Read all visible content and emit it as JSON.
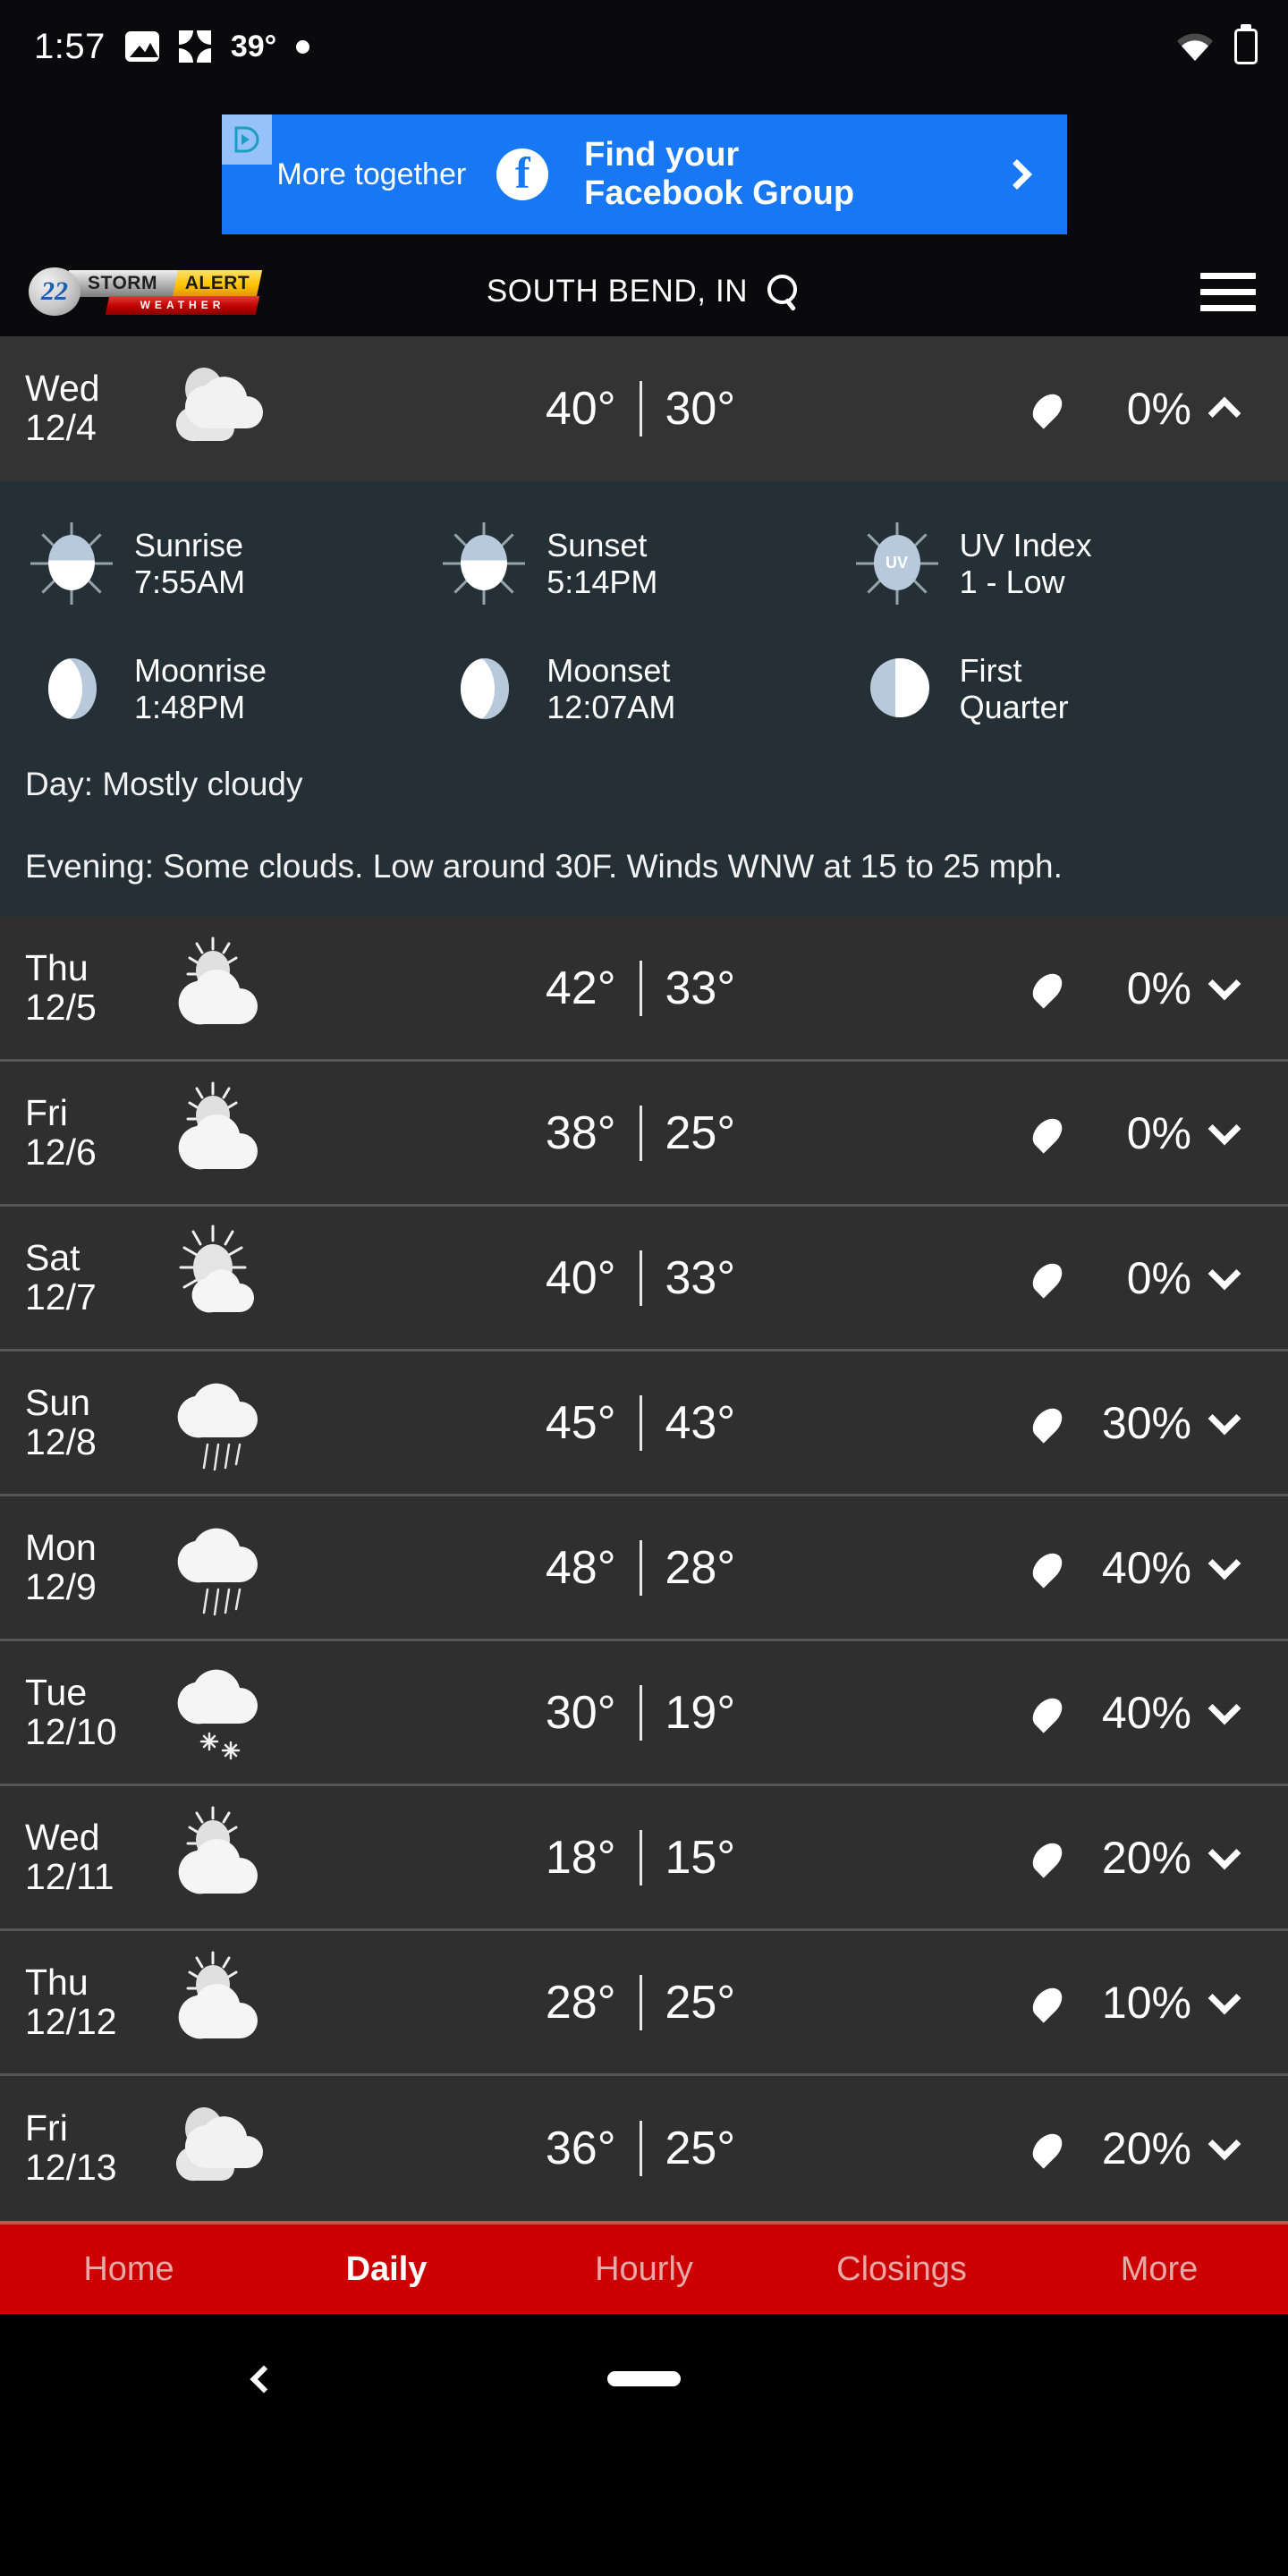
{
  "status_bar": {
    "time": "1:57",
    "temperature": "39°",
    "icons": [
      "photos-icon",
      "pinwheel-icon",
      "dot-icon",
      "wifi-icon",
      "battery-charging-icon"
    ]
  },
  "ad": {
    "badge": "ad-choices-icon",
    "tagline": "More together",
    "brand_icon": "facebook-icon",
    "headline_line1": "Find your",
    "headline_line2": "Facebook Group",
    "arrow": "chevron-right-icon",
    "bg_color": "#1877f2"
  },
  "header": {
    "logo": {
      "channel": "22",
      "word1": "STORM",
      "word2": "ALERT",
      "word3": "WEATHER"
    },
    "city": "SOUTH BEND, IN",
    "search_icon": "search-icon",
    "menu_icon": "hamburger-menu-icon"
  },
  "forecast": {
    "days": [
      {
        "day": "Wed",
        "date": "12/4",
        "icon": "mostly-cloudy-icon",
        "high": "40°",
        "low": "30°",
        "precip": "0%",
        "expanded": true
      },
      {
        "day": "Thu",
        "date": "12/5",
        "icon": "partly-sunny-icon",
        "high": "42°",
        "low": "33°",
        "precip": "0%",
        "expanded": false
      },
      {
        "day": "Fri",
        "date": "12/6",
        "icon": "partly-sunny-icon",
        "high": "38°",
        "low": "25°",
        "precip": "0%",
        "expanded": false
      },
      {
        "day": "Sat",
        "date": "12/7",
        "icon": "mostly-sunny-icon",
        "high": "40°",
        "low": "33°",
        "precip": "0%",
        "expanded": false
      },
      {
        "day": "Sun",
        "date": "12/8",
        "icon": "rain-icon",
        "high": "45°",
        "low": "43°",
        "precip": "30%",
        "expanded": false
      },
      {
        "day": "Mon",
        "date": "12/9",
        "icon": "rain-icon",
        "high": "48°",
        "low": "28°",
        "precip": "40%",
        "expanded": false
      },
      {
        "day": "Tue",
        "date": "12/10",
        "icon": "snow-icon",
        "high": "30°",
        "low": "19°",
        "precip": "40%",
        "expanded": false
      },
      {
        "day": "Wed",
        "date": "12/11",
        "icon": "partly-sunny-icon",
        "high": "18°",
        "low": "15°",
        "precip": "20%",
        "expanded": false
      },
      {
        "day": "Thu",
        "date": "12/12",
        "icon": "partly-sunny-icon",
        "high": "28°",
        "low": "25°",
        "precip": "10%",
        "expanded": false
      },
      {
        "day": "Fri",
        "date": "12/13",
        "icon": "mostly-cloudy-icon",
        "high": "36°",
        "low": "25°",
        "precip": "20%",
        "expanded": false
      }
    ],
    "expanded_detail": {
      "astro": [
        {
          "icon": "sunrise-icon",
          "label": "Sunrise",
          "value": "7:55AM"
        },
        {
          "icon": "sunset-icon",
          "label": "Sunset",
          "value": "5:14PM"
        },
        {
          "icon": "uv-index-icon",
          "label": "UV Index",
          "value": "1 - Low"
        },
        {
          "icon": "moonrise-icon",
          "label": "Moonrise",
          "value": "1:48PM"
        },
        {
          "icon": "moonset-icon",
          "label": "Moonset",
          "value": "12:07AM"
        },
        {
          "icon": "moon-phase-icon",
          "label": "First",
          "value": "Quarter"
        }
      ],
      "day_text": "Day: Mostly cloudy",
      "evening_text": "Evening: Some clouds. Low around 30F. Winds WNW at 15 to 25 mph."
    }
  },
  "bottom_nav": {
    "items": [
      {
        "label": "Home",
        "active": false
      },
      {
        "label": "Daily",
        "active": true
      },
      {
        "label": "Hourly",
        "active": false
      },
      {
        "label": "Closings",
        "active": false
      },
      {
        "label": "More",
        "active": false
      }
    ],
    "bg_color": "#cc0000"
  },
  "system_nav": {
    "back_icon": "back-chevron-icon",
    "home_icon": "home-pill-icon"
  }
}
